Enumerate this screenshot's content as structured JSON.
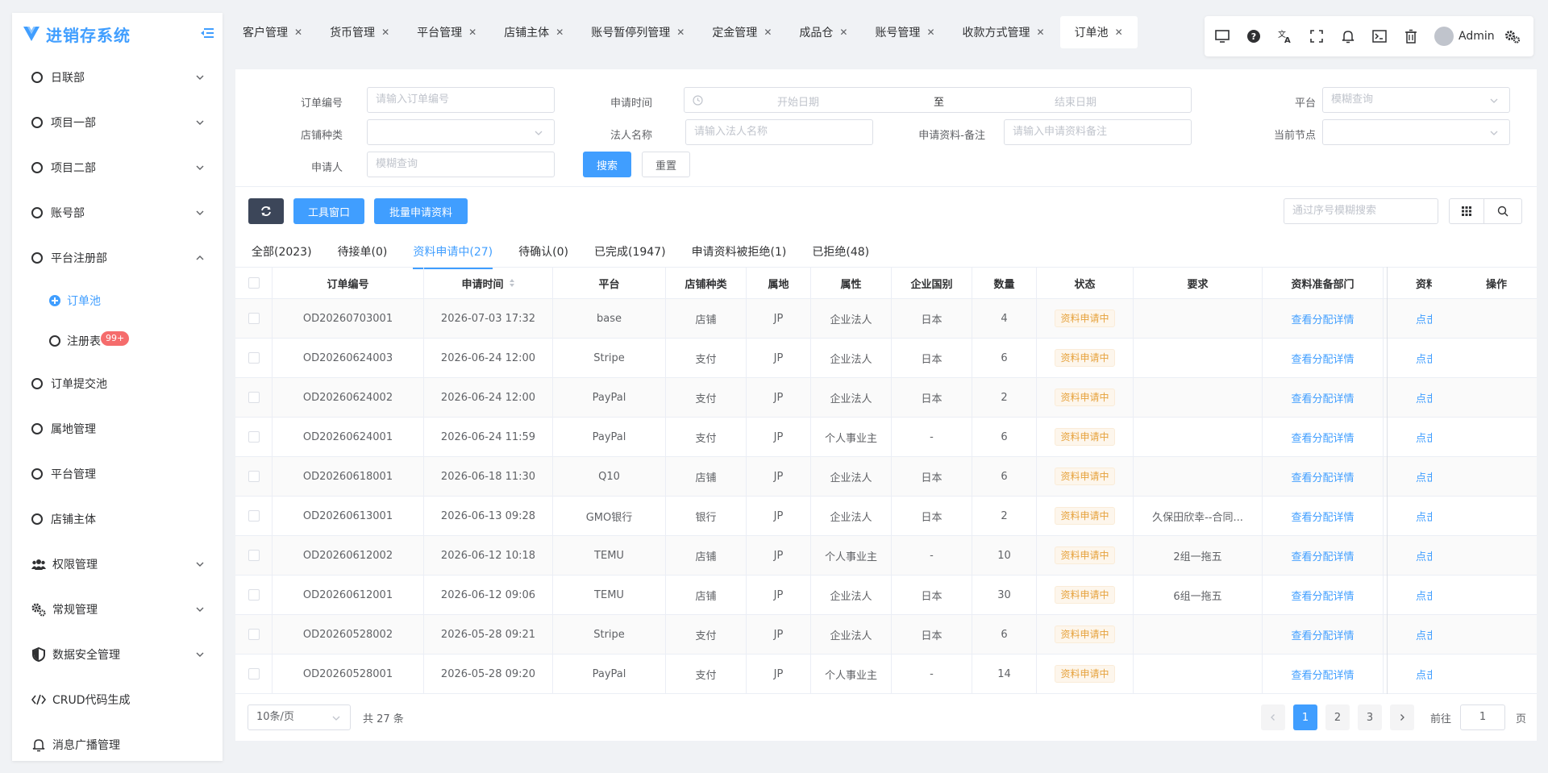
{
  "brand": {
    "title": "进销存系统"
  },
  "sidebar": {
    "items": [
      {
        "label": "日联部",
        "expand": "down"
      },
      {
        "label": "项目一部",
        "expand": "down"
      },
      {
        "label": "项目二部",
        "expand": "down"
      },
      {
        "label": "账号部",
        "expand": "down"
      },
      {
        "label": "平台注册部",
        "expand": "up"
      }
    ],
    "subitems": [
      {
        "label": "订单池",
        "active": true
      },
      {
        "label": "注册表",
        "badge": "99+"
      }
    ],
    "items2": [
      {
        "label": "订单提交池"
      },
      {
        "label": "属地管理"
      },
      {
        "label": "平台管理"
      },
      {
        "label": "店铺主体"
      }
    ],
    "items3": [
      {
        "label": "权限管理",
        "icon": "users-icon"
      },
      {
        "label": "常规管理",
        "icon": "gears-icon"
      },
      {
        "label": "数据安全管理",
        "icon": "shield-icon"
      },
      {
        "label": "CRUD代码生成",
        "icon": "code-icon"
      },
      {
        "label": "消息广播管理",
        "icon": "bell-icon"
      }
    ]
  },
  "tabs": [
    "客户管理",
    "货币管理",
    "平台管理",
    "店铺主体",
    "账号暂停列管理",
    "定金管理",
    "成品仓",
    "账号管理",
    "收款方式管理",
    "订单池"
  ],
  "topbar": {
    "user": "Admin"
  },
  "filters": {
    "order_no_label": "订单编号",
    "order_no_ph": "请输入订单编号",
    "apply_time_label": "申请时间",
    "start_ph": "开始日期",
    "range_sep": "至",
    "end_ph": "结束日期",
    "platform_label": "平台",
    "platform_ph": "模糊查询",
    "shop_type_label": "店铺种类",
    "legal_label": "法人名称",
    "legal_ph": "请输入法人名称",
    "remark_label": "申请资料-备注",
    "remark_ph": "请输入申请资料备注",
    "node_label": "当前节点",
    "applicant_label": "申请人",
    "applicant_ph": "模糊查询",
    "search_btn": "搜索",
    "reset_btn": "重置"
  },
  "toolbar": {
    "tool_btn": "工具窗口",
    "batch_btn": "批量申请资料",
    "search_ph": "通过序号模糊搜索"
  },
  "status_tabs": [
    "全部(2023)",
    "待接单(0)",
    "资料申请中(27)",
    "待确认(0)",
    "已完成(1947)",
    "申请资料被拒绝(1)",
    "已拒绝(48)"
  ],
  "table": {
    "headers": [
      "订单编号",
      "申请时间",
      "平台",
      "店铺种类",
      "属地",
      "属性",
      "企业国别",
      "数量",
      "状态",
      "要求",
      "资料准备部门",
      "资料",
      "操作"
    ],
    "rows": [
      [
        "OD20260703001",
        "2026-07-03 17:32",
        "base",
        "店铺",
        "JP",
        "企业法人",
        "日本",
        "4",
        "资料申请中",
        "",
        "查看分配详情",
        "点击"
      ],
      [
        "OD20260624003",
        "2026-06-24 12:00",
        "Stripe",
        "支付",
        "JP",
        "企业法人",
        "日本",
        "6",
        "资料申请中",
        "",
        "查看分配详情",
        "点击"
      ],
      [
        "OD20260624002",
        "2026-06-24 12:00",
        "PayPal",
        "支付",
        "JP",
        "企业法人",
        "日本",
        "2",
        "资料申请中",
        "",
        "查看分配详情",
        "点击"
      ],
      [
        "OD20260624001",
        "2026-06-24 11:59",
        "PayPal",
        "支付",
        "JP",
        "个人事业主",
        "-",
        "6",
        "资料申请中",
        "",
        "查看分配详情",
        "点击"
      ],
      [
        "OD20260618001",
        "2026-06-18 11:30",
        "Q10",
        "店铺",
        "JP",
        "企业法人",
        "日本",
        "6",
        "资料申请中",
        "",
        "查看分配详情",
        "点击"
      ],
      [
        "OD20260613001",
        "2026-06-13 09:28",
        "GMO银行",
        "银行",
        "JP",
        "企业法人",
        "日本",
        "2",
        "资料申请中",
        "久保田欣幸--合同...",
        "查看分配详情",
        "点击"
      ],
      [
        "OD20260612002",
        "2026-06-12 10:18",
        "TEMU",
        "店铺",
        "JP",
        "个人事业主",
        "-",
        "10",
        "资料申请中",
        "2组一拖五",
        "查看分配详情",
        "点击"
      ],
      [
        "OD20260612001",
        "2026-06-12 09:06",
        "TEMU",
        "店铺",
        "JP",
        "企业法人",
        "日本",
        "30",
        "资料申请中",
        "6组一拖五",
        "查看分配详情",
        "点击"
      ],
      [
        "OD20260528002",
        "2026-05-28 09:21",
        "Stripe",
        "支付",
        "JP",
        "企业法人",
        "日本",
        "6",
        "资料申请中",
        "",
        "查看分配详情",
        "点击"
      ],
      [
        "OD20260528001",
        "2026-05-28 09:20",
        "PayPal",
        "支付",
        "JP",
        "个人事业主",
        "-",
        "14",
        "资料申请中",
        "",
        "查看分配详情",
        "点击"
      ]
    ]
  },
  "pager": {
    "size": "10条/页",
    "total": "共 27 条",
    "pages": [
      "1",
      "2",
      "3"
    ],
    "goto_label": "前往",
    "goto_value": "1",
    "goto_suffix": "页"
  }
}
